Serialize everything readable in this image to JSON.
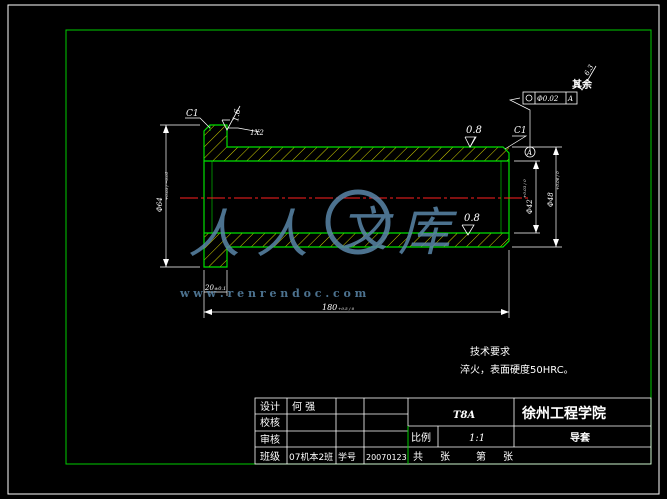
{
  "drawing": {
    "chamfer_left": "C1",
    "chamfer_right": "C1",
    "roughness_top_left": "1.6",
    "roughness_top_right": "0.8",
    "roughness_inner": "0.8",
    "small_chamfer": "1X2",
    "dim_left_dia": "Φ64",
    "dim_left_dia_tol": "+0.03 / −0.01",
    "dim_inner_dia": "Φ42",
    "dim_inner_dia_tol": "+0.03 / 0",
    "dim_right_dia": "Φ48",
    "dim_right_dia_tol": "+0.06 / 0",
    "dim_length": "180",
    "dim_length_tol": "+0.5 / 0",
    "dim_shoulder": "20",
    "dim_shoulder_tol": "±0.1",
    "datum_label": "A",
    "tolerance_value": "Φ0.02",
    "tolerance_datum": "A",
    "remaining_finish": "其余",
    "remaining_finish_value": "6.3",
    "watermark_url": "w w w . r e n r e n d o c . c o m",
    "watermark_chars": [
      "人",
      "人",
      "文",
      "库"
    ]
  },
  "notes": {
    "title": "技术要求",
    "line1": "淬火，表面硬度50HRC。"
  },
  "title_block": {
    "design_label": "设计",
    "design_value": "何  强",
    "check_label": "校核",
    "review_label": "审核",
    "class_label": "班级",
    "class_value": "07机本2班",
    "student_id_label": "学号",
    "student_id_value": "20070123",
    "material": "T8A",
    "school": "徐州工程学院",
    "scale_label": "比例",
    "scale_value": "1:1",
    "part_name": "导套",
    "total_label": "共",
    "sheet_unit": "张",
    "page_label": "第",
    "page_unit": "张"
  }
}
